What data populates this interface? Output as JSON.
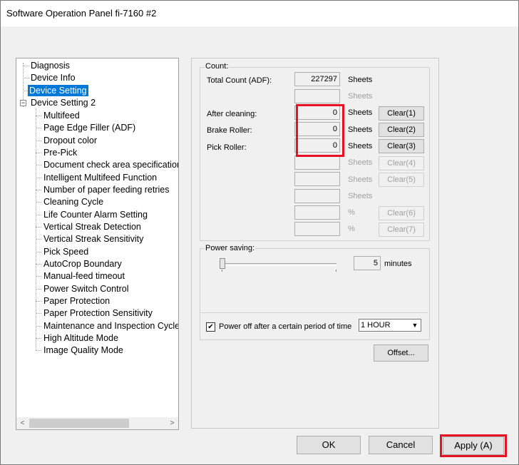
{
  "window": {
    "title": "Software Operation Panel fi-7160 #2"
  },
  "tree": {
    "items": [
      {
        "label": "Diagnosis"
      },
      {
        "label": "Device Info"
      },
      {
        "label": "Device Setting"
      },
      {
        "label": "Device Setting 2"
      },
      {
        "label": "Multifeed"
      },
      {
        "label": "Page Edge Filler (ADF)"
      },
      {
        "label": "Dropout color"
      },
      {
        "label": "Pre-Pick"
      },
      {
        "label": "Document check area specification"
      },
      {
        "label": "Intelligent Multifeed Function"
      },
      {
        "label": "Number of paper feeding retries"
      },
      {
        "label": "Cleaning Cycle"
      },
      {
        "label": "Life Counter Alarm Setting"
      },
      {
        "label": "Vertical Streak Detection"
      },
      {
        "label": "Vertical Streak Sensitivity"
      },
      {
        "label": "Pick Speed"
      },
      {
        "label": "AutoCrop Boundary"
      },
      {
        "label": "Manual-feed timeout"
      },
      {
        "label": "Power Switch Control"
      },
      {
        "label": "Paper Protection"
      },
      {
        "label": "Paper Protection Sensitivity"
      },
      {
        "label": "Maintenance and Inspection Cycle"
      },
      {
        "label": "High Altitude Mode"
      },
      {
        "label": "Image Quality Mode"
      }
    ],
    "expander_symbol": "−",
    "scroll_left": "<",
    "scroll_right": ">"
  },
  "count": {
    "title": "Count:",
    "rows": [
      {
        "label": "Total Count (ADF):",
        "value": "227297",
        "unit": "Sheets",
        "button": ""
      },
      {
        "label": "",
        "value": "",
        "unit": "Sheets",
        "button": ""
      },
      {
        "label": "After cleaning:",
        "value": "0",
        "unit": "Sheets",
        "button": "Clear(1)"
      },
      {
        "label": "Brake Roller:",
        "value": "0",
        "unit": "Sheets",
        "button": "Clear(2)"
      },
      {
        "label": "Pick Roller:",
        "value": "0",
        "unit": "Sheets",
        "button": "Clear(3)"
      },
      {
        "label": "",
        "value": "",
        "unit": "Sheets",
        "button": "Clear(4)"
      },
      {
        "label": "",
        "value": "",
        "unit": "Sheets",
        "button": "Clear(5)"
      },
      {
        "label": "",
        "value": "",
        "unit": "Sheets",
        "button": ""
      },
      {
        "label": "",
        "value": "",
        "unit": "%",
        "button": "Clear(6)"
      },
      {
        "label": "",
        "value": "",
        "unit": "%",
        "button": "Clear(7)"
      }
    ]
  },
  "power": {
    "title": "Power saving:",
    "minutes_value": "5",
    "minutes_unit": "minutes",
    "checkbox_mark": "✔",
    "checkbox_label": "Power off after a certain period of time",
    "select_value": "1 HOUR",
    "select_arrow": "▼"
  },
  "buttons": {
    "offset": "Offset...",
    "ok": "OK",
    "cancel": "Cancel",
    "apply": "Apply (A)"
  },
  "colors": {
    "highlight": "#e81123",
    "selection": "#0078d7"
  }
}
